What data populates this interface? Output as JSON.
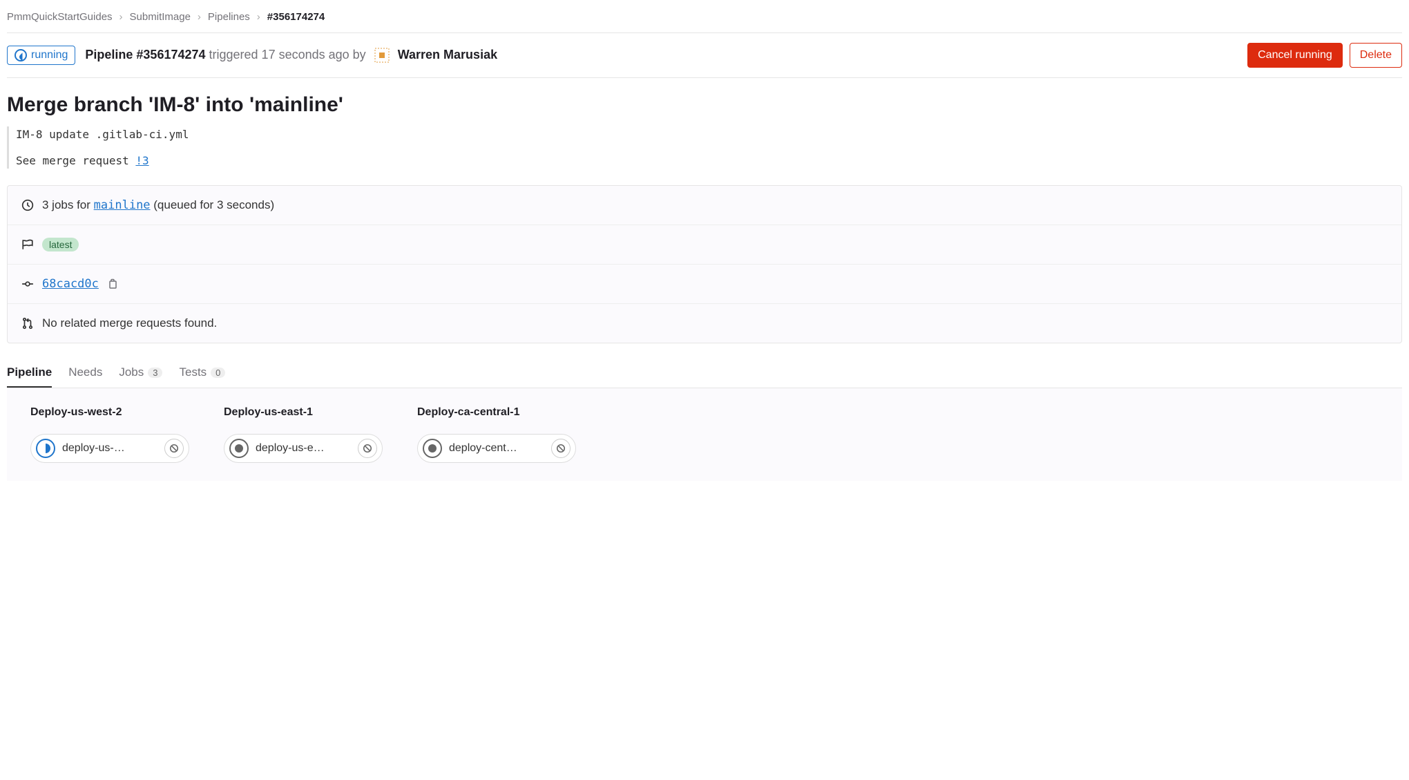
{
  "breadcrumb": {
    "items": [
      "PmmQuickStartGuides",
      "SubmitImage",
      "Pipelines"
    ],
    "current": "#356174274"
  },
  "header": {
    "status_label": "running",
    "pipeline_prefix": "Pipeline ",
    "pipeline_id": "#356174274",
    "triggered_text": " triggered 17 seconds ago by",
    "author": "Warren Marusiak",
    "cancel_label": "Cancel running",
    "delete_label": "Delete"
  },
  "commit": {
    "title": "Merge branch 'IM-8' into 'mainline'",
    "desc_line1": "IM-8 update .gitlab-ci.yml",
    "desc_line2": "See merge request ",
    "mr_ref": "!3"
  },
  "info": {
    "jobs_prefix": "3 jobs for ",
    "branch": "mainline",
    "jobs_suffix": " (queued for 3 seconds)",
    "latest_label": "latest",
    "sha": "68cacd0c",
    "no_mr": "No related merge requests found."
  },
  "tabs": {
    "pipeline": "Pipeline",
    "needs": "Needs",
    "jobs": "Jobs",
    "jobs_count": "3",
    "tests": "Tests",
    "tests_count": "0"
  },
  "stages": [
    {
      "name": "Deploy-us-west-2",
      "job": "deploy-us-…",
      "status": "running"
    },
    {
      "name": "Deploy-us-east-1",
      "job": "deploy-us-e…",
      "status": "manual"
    },
    {
      "name": "Deploy-ca-central-1",
      "job": "deploy-cent…",
      "status": "manual"
    }
  ]
}
